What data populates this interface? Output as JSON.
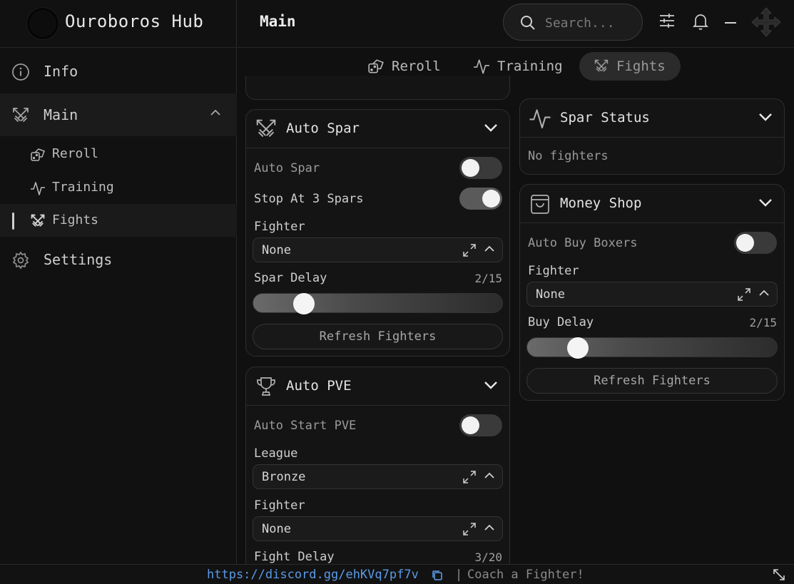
{
  "app": {
    "title": "Ouroboros Hub"
  },
  "sidebar": {
    "info": "Info",
    "main": "Main",
    "sub": [
      "Reroll",
      "Training",
      "Fights"
    ],
    "settings": "Settings"
  },
  "header": {
    "page_title": "Main",
    "search_placeholder": "Search..."
  },
  "tabs": [
    "Reroll",
    "Training",
    "Fights"
  ],
  "auto_spar": {
    "title": "Auto Spar",
    "auto_spar_label": "Auto Spar",
    "auto_spar_on": false,
    "stop_label": "Stop At 3 Spars",
    "stop_on": true,
    "fighter_label": "Fighter",
    "fighter_value": "None",
    "delay_label": "Spar Delay",
    "delay_value": "2/15",
    "delay_current": 2,
    "delay_max": 15,
    "refresh_label": "Refresh Fighters"
  },
  "auto_pve": {
    "title": "Auto PVE",
    "start_label": "Auto Start PVE",
    "start_on": false,
    "league_label": "League",
    "league_value": "Bronze",
    "fighter_label": "Fighter",
    "fighter_value": "None",
    "delay_label": "Fight Delay",
    "delay_value": "3/20"
  },
  "spar_status": {
    "title": "Spar Status",
    "text": "No fighters"
  },
  "money_shop": {
    "title": "Money Shop",
    "auto_buy_label": "Auto Buy Boxers",
    "auto_buy_on": false,
    "fighter_label": "Fighter",
    "fighter_value": "None",
    "delay_label": "Buy Delay",
    "delay_value": "2/15",
    "delay_current": 2,
    "delay_max": 15,
    "refresh_label": "Refresh Fighters"
  },
  "footer": {
    "link": "https://discord.gg/ehKVq7pf7v",
    "separator": "|",
    "text": "Coach a Fighter!"
  },
  "colors": {
    "link": "#5b9be8",
    "accent": "#f2f2f2",
    "background": "#101010"
  }
}
